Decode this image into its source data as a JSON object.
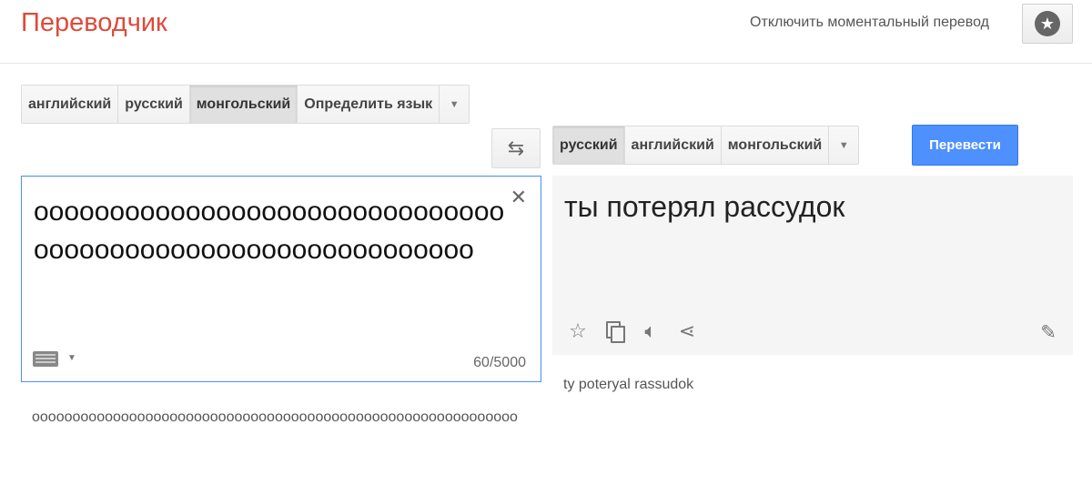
{
  "header": {
    "title": "Переводчик",
    "instant_toggle": "Отключить моментальный перевод",
    "star_icon": "star-icon"
  },
  "source": {
    "languages": [
      "английский",
      "русский",
      "монгольский",
      "Определить язык"
    ],
    "selected": "монгольский",
    "text": "оооооооооооооооооооооооооооооооооооооооооооооооооооооооооооо",
    "char_count": "60/5000",
    "transliteration": "оооооооооооооооооооооооооооооооооооооооооооооооооооооооооооо"
  },
  "target": {
    "languages": [
      "русский",
      "английский",
      "монгольский"
    ],
    "selected": "русский",
    "translate_button": "Перевести",
    "text": "ты потерял рассудок",
    "transliteration": "ty poteryal rassudok"
  },
  "colors": {
    "brand": "#dd4b39",
    "accent": "#4d90fe"
  }
}
